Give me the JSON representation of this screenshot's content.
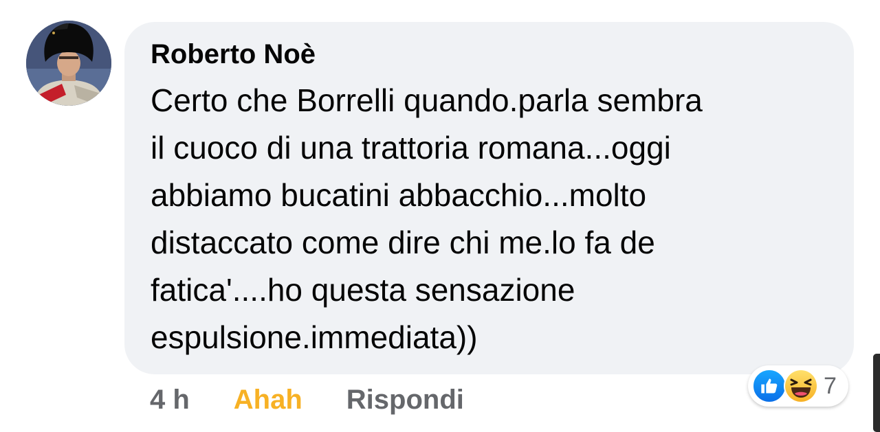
{
  "comment": {
    "author": "Roberto Noè",
    "text_lines": [
      "Certo che Borrelli quando.parla sembra",
      "il cuoco di una trattoria romana...oggi",
      "abbiamo bucatini abbacchio...molto",
      "distaccato come dire chi me.lo fa de",
      "fatica'....ho questa sensazione",
      "espulsione.immediata))"
    ]
  },
  "actions": {
    "time": "4 h",
    "reaction_label": "Ahah",
    "reply_label": "Rispondi"
  },
  "reactions": {
    "icons": [
      "like-icon",
      "haha-icon"
    ],
    "count": "7"
  },
  "colors": {
    "bubble": "#f0f2f5",
    "text": "#050505",
    "muted": "#65676b",
    "haha": "#f7b125",
    "like": "#1877f2"
  }
}
